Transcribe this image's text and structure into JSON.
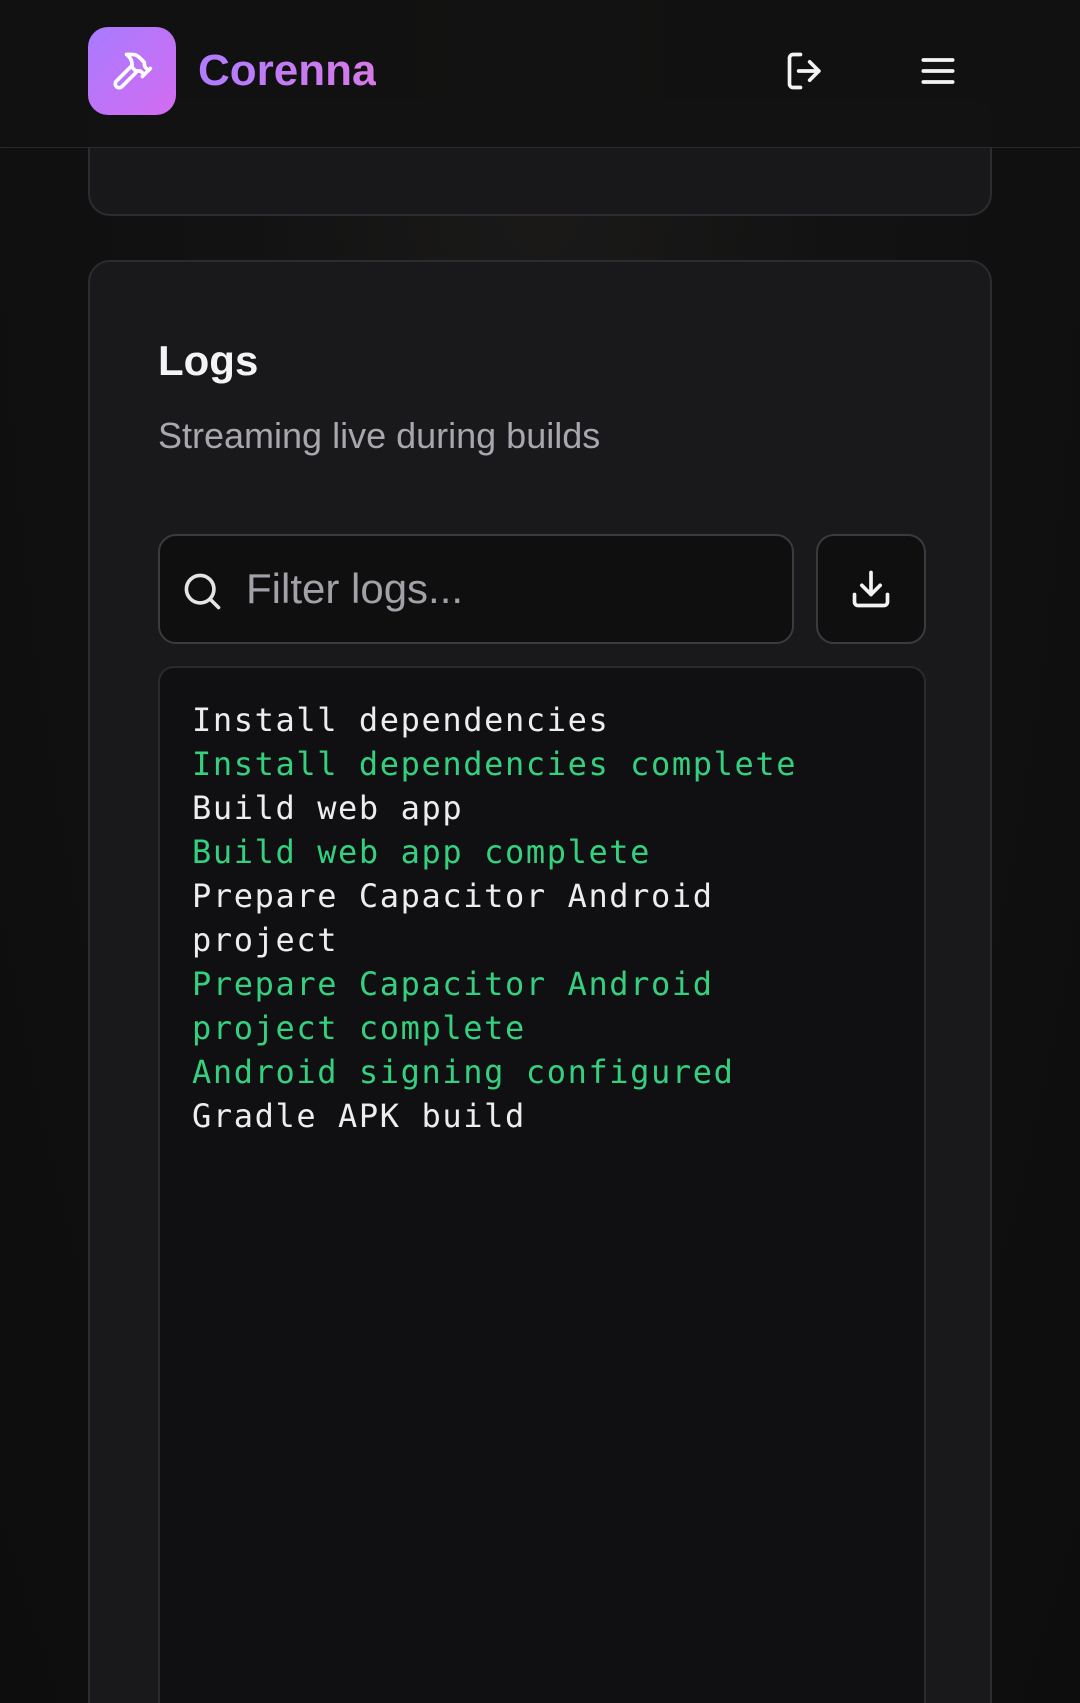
{
  "header": {
    "app_name": "Corenna",
    "logo_icon": "hammer-icon",
    "logout_icon": "logout-icon",
    "menu_icon": "menu-icon"
  },
  "logs": {
    "title": "Logs",
    "subtitle": "Streaming live during builds",
    "filter": {
      "value": "",
      "placeholder": "Filter logs..."
    },
    "download_icon": "download-icon",
    "lines": [
      {
        "text": "Install dependencies",
        "status": "info"
      },
      {
        "text": "Install dependencies complete",
        "status": "success"
      },
      {
        "text": "Build web app",
        "status": "info"
      },
      {
        "text": "Build web app complete",
        "status": "success"
      },
      {
        "text": "Prepare Capacitor Android project",
        "status": "info"
      },
      {
        "text": "Prepare Capacitor Android project complete",
        "status": "success"
      },
      {
        "text": "Android signing configured",
        "status": "success"
      },
      {
        "text": "Gradle APK build",
        "status": "info"
      }
    ]
  },
  "colors": {
    "accent_start": "#a77bff",
    "accent_end": "#d46cf0",
    "success": "#35d07f",
    "info": "#ededee"
  }
}
